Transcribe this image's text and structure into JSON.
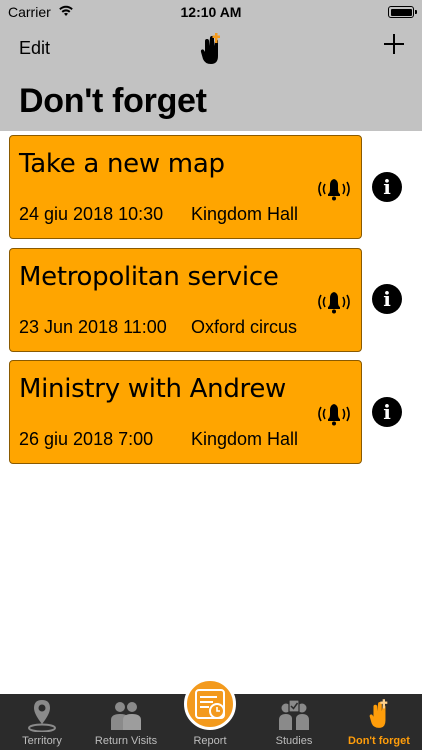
{
  "status_bar": {
    "carrier": "Carrier",
    "time": "12:10 AM"
  },
  "nav": {
    "edit_label": "Edit",
    "title": "Don't forget",
    "add_icon": "plus-icon",
    "logo_icon": "finger-ribbon-icon"
  },
  "reminders": [
    {
      "title": "Take a new map",
      "date": "24 giu 2018 10:30",
      "place": "Kingdom Hall"
    },
    {
      "title": "Metropolitan service",
      "date": "23 Jun 2018 11:00",
      "place": "Oxford circus"
    },
    {
      "title": "Ministry with Andrew",
      "date": "26 giu 2018 7:00",
      "place": "Kingdom Hall"
    }
  ],
  "tabs": [
    {
      "label": "Territory",
      "icon": "map-pin-icon"
    },
    {
      "label": "Return Visits",
      "icon": "people-icon"
    },
    {
      "label": "Report",
      "icon": "report-clock-icon"
    },
    {
      "label": "Studies",
      "icon": "studies-icon"
    },
    {
      "label": "Don't forget",
      "icon": "finger-ribbon-icon",
      "active": true
    }
  ],
  "colors": {
    "card": "#ffa500",
    "accent": "#ff9d0a",
    "tabbar": "#2b2b2b",
    "header": "#c2c2c2"
  }
}
